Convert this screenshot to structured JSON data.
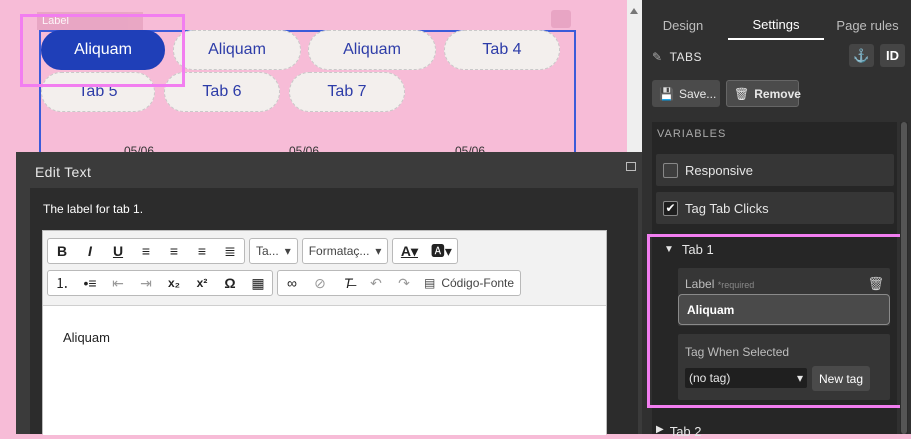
{
  "canvas": {
    "label_badge": "Label",
    "tabs": [
      {
        "label": "Aliquam",
        "active": true
      },
      {
        "label": "Aliquam",
        "active": false
      },
      {
        "label": "Aliquam",
        "active": false
      },
      {
        "label": "Tab 4",
        "active": false
      },
      {
        "label": "Tab 5",
        "active": false
      },
      {
        "label": "Tab 6",
        "active": false
      },
      {
        "label": "Tab 7",
        "active": false
      }
    ],
    "dates": [
      "05/06",
      "05/06",
      "05/06"
    ]
  },
  "modal": {
    "title": "Edit Text",
    "description": "The label for tab 1.",
    "toolbar": {
      "size_dropdown": "Ta...",
      "format_dropdown": "Formataç...",
      "source_label": "Código-Fonte"
    },
    "content": "Aliquam"
  },
  "panel": {
    "tabs": [
      "Design",
      "Settings",
      "Page rules"
    ],
    "active_tab": "Settings",
    "section_title": "TABS",
    "id_button": "ID",
    "save_label": "Save...",
    "remove_label": "Remove",
    "variables_header": "VARIABLES",
    "responsive_label": "Responsive",
    "tag_clicks_label": "Tag Tab Clicks",
    "tab1": {
      "title": "Tab 1",
      "label_title": "Label",
      "required": "*required",
      "label_value": "Aliquam",
      "tag_title": "Tag When Selected",
      "tag_value": "(no tag)",
      "new_tag": "New tag"
    },
    "tab2_title": "Tab 2"
  },
  "colors": {
    "canvas_bg": "#f7bcd7",
    "active_tab": "#1f3fb8",
    "highlight": "#f27ef0",
    "panel_bg": "#303030"
  }
}
